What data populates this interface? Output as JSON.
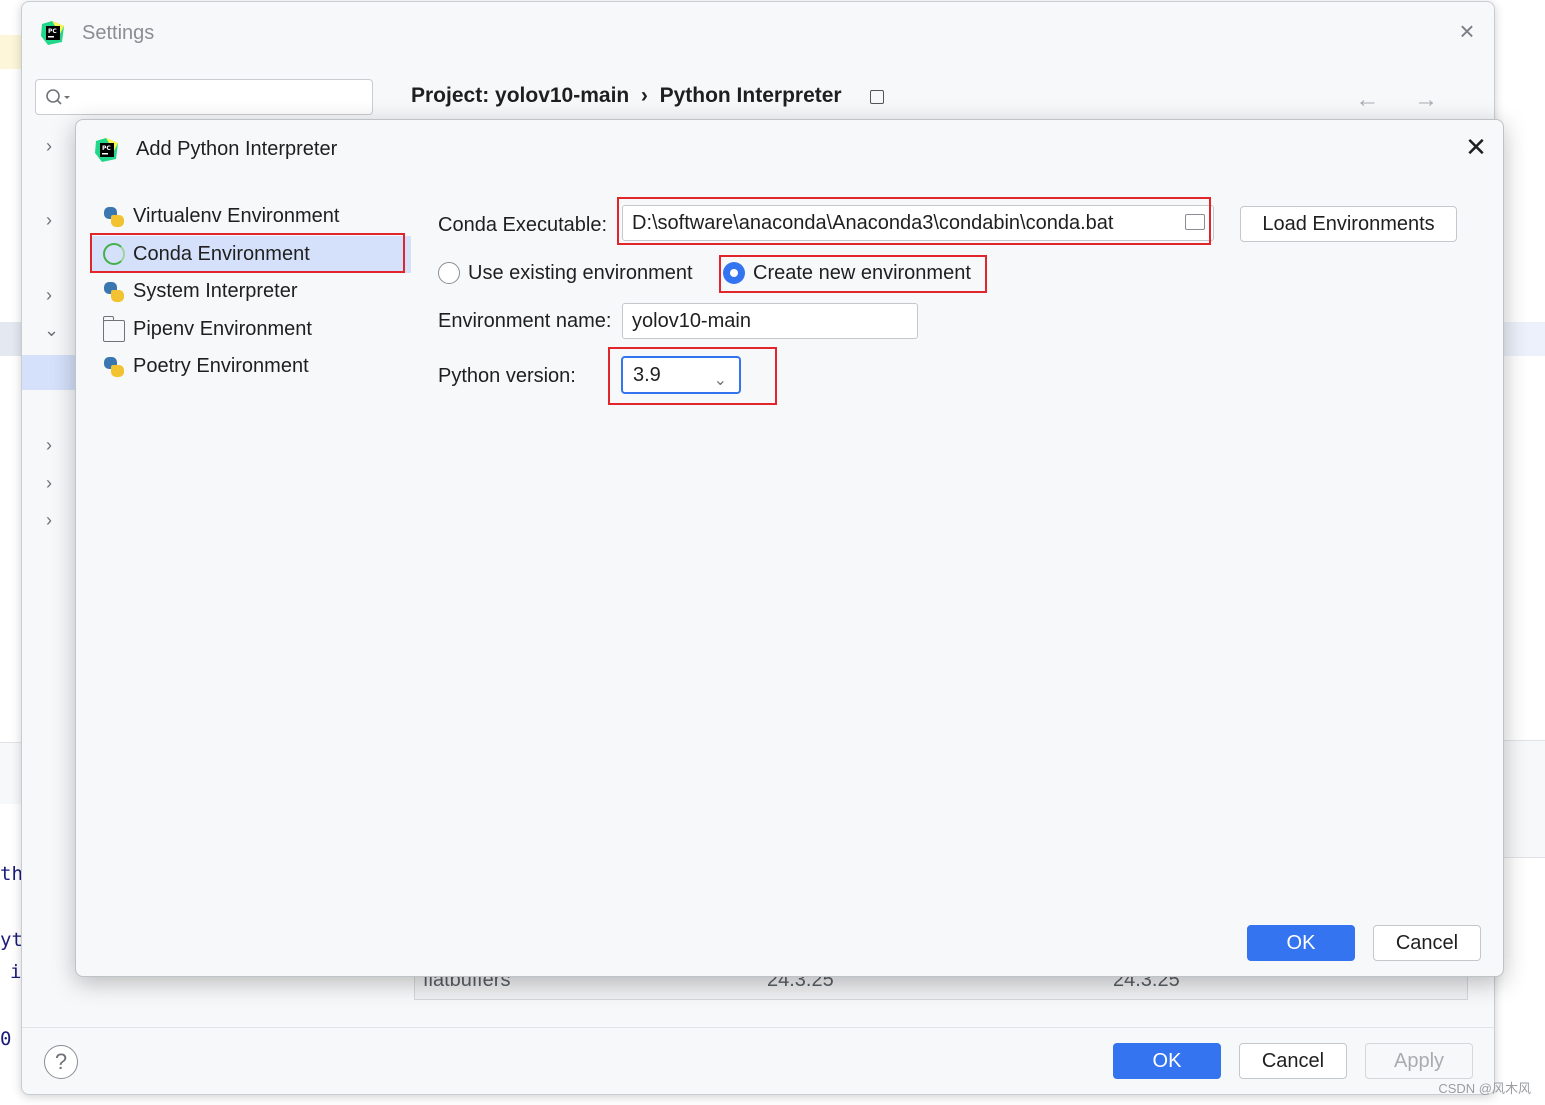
{
  "settings": {
    "title": "Settings",
    "breadcrumb": "Project: yolov10-main  ›  Python Interpreter",
    "nav_arrows": "← →",
    "help_label": "?",
    "ok_label": "OK",
    "cancel_label": "Cancel",
    "apply_label": "Apply",
    "package_row": {
      "name": "flatbuffers",
      "version": "24.3.25",
      "latest": "24.3.25"
    }
  },
  "background_code": [
    "th",
    "yt",
    "i",
    "0"
  ],
  "dialog": {
    "title": "Add Python Interpreter",
    "environments": [
      {
        "label": "Virtualenv Environment",
        "icon": "python-icon",
        "selected": false
      },
      {
        "label": "Conda Environment",
        "icon": "conda-icon",
        "selected": true
      },
      {
        "label": "System Interpreter",
        "icon": "python-icon",
        "selected": false
      },
      {
        "label": "Pipenv Environment",
        "icon": "folder-icon",
        "selected": false
      },
      {
        "label": "Poetry Environment",
        "icon": "python-icon",
        "selected": false
      }
    ],
    "conda_exec_label": "Conda Executable:",
    "conda_exec_value": "D:\\software\\anaconda\\Anaconda3\\condabin\\conda.bat",
    "load_env_label": "Load Environments",
    "radio_existing_label": "Use existing environment",
    "radio_new_label": "Create new environment",
    "radio_selected": "new",
    "env_name_label": "Environment name:",
    "env_name_value": "yolov10-main",
    "python_version_label": "Python version:",
    "python_version_value": "3.9",
    "ok_label": "OK",
    "cancel_label": "Cancel"
  },
  "colors": {
    "accent": "#3574f0",
    "highlight": "#e0262a",
    "selection": "#d5e1fa"
  },
  "watermark": "CSDN @风木风"
}
